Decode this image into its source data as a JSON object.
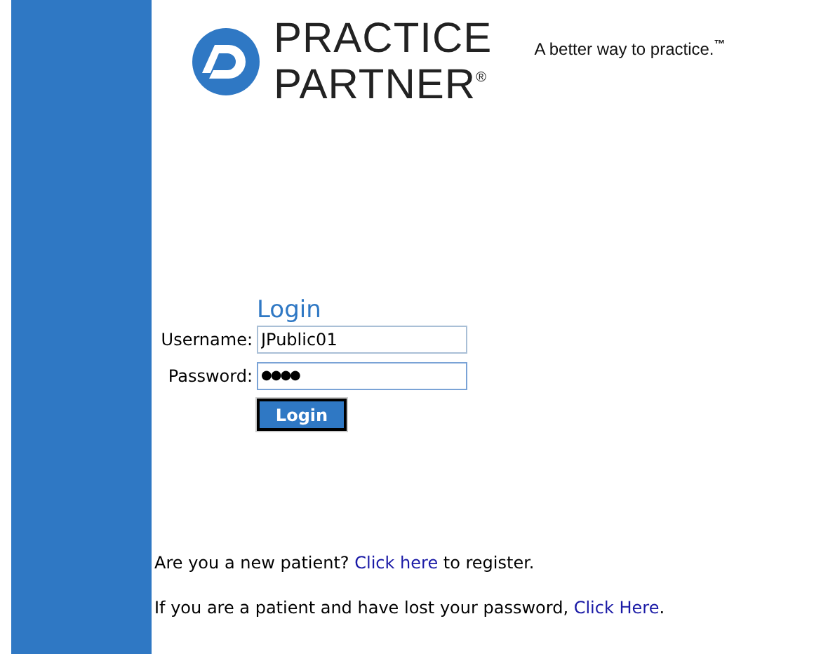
{
  "header": {
    "brand_line_1": "PRACTICE",
    "brand_line_2": "PARTNER$^{®}$",
    "tagline": "A better way to practice.$^{™}$"
  },
  "login": {
    "title": "Login",
    "fields": [
      {
        "label": "Username:",
        "value": "JPublic01",
        "kind": "text",
        "focused": false
      },
      {
        "label": "Password:",
        "value": "●●●●",
        "kind": "password",
        "focused": true
      }
    ],
    "button": "Login"
  },
  "messages": [
    {
      "before": "Are you a new patient? ",
      "link": "Click here",
      "after": " to register."
    },
    {
      "before": "If you are a patient and have lost your password, ",
      "link": "Click Here",
      "after": "."
    }
  ]
}
